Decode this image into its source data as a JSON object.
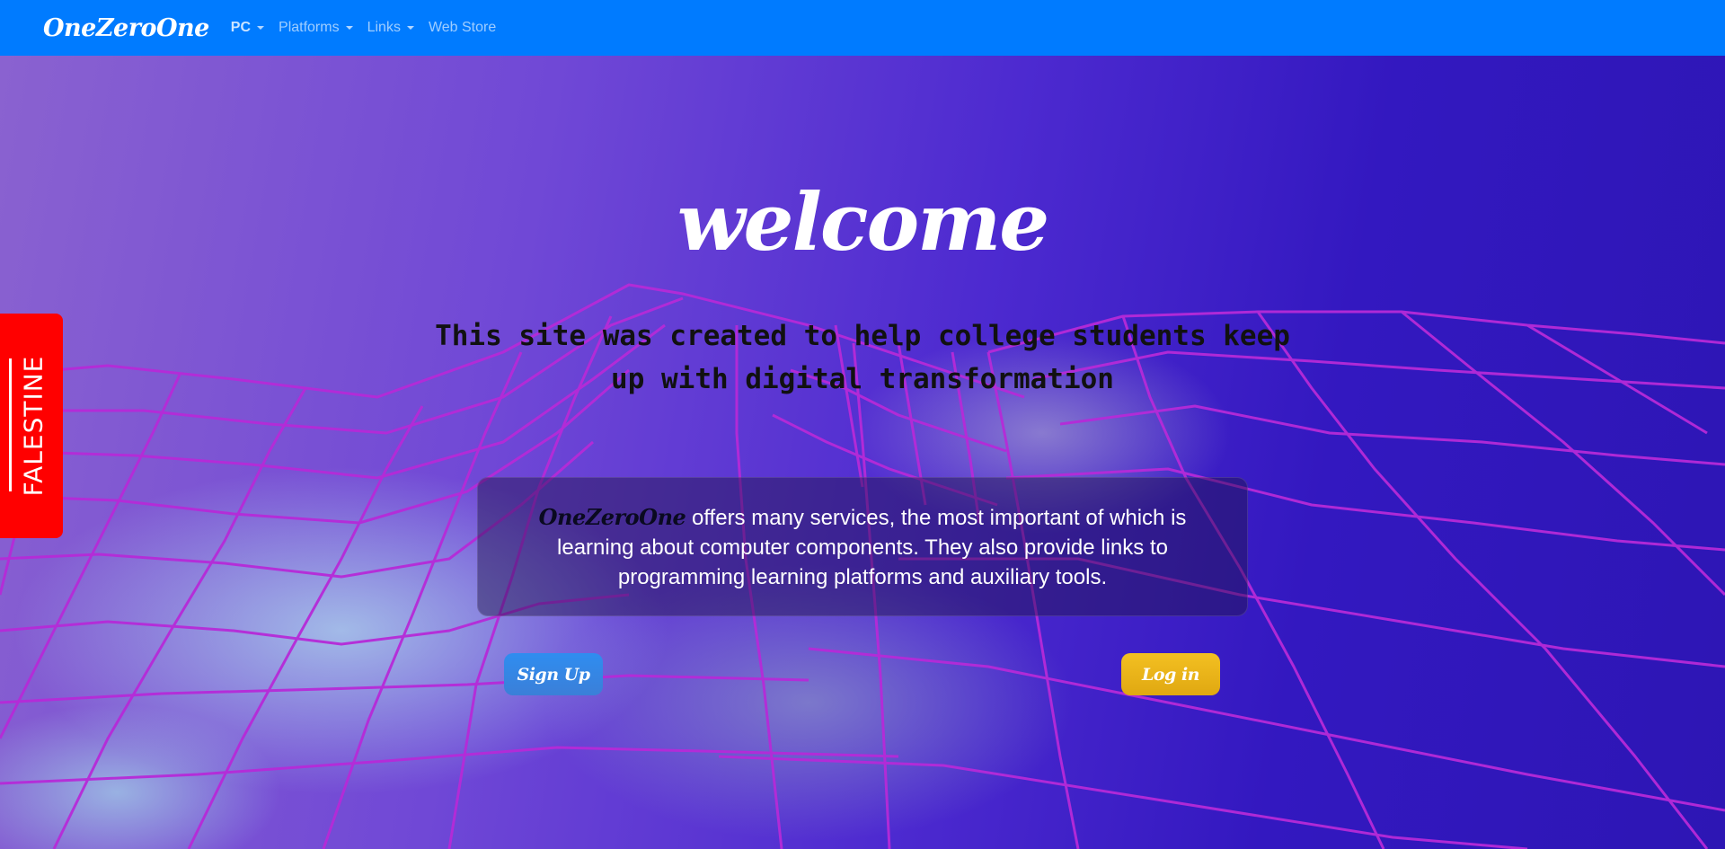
{
  "nav": {
    "brand": "OneZeroOne",
    "items": [
      {
        "label": "PC",
        "dropdown": true
      },
      {
        "label": "Platforms",
        "dropdown": true
      },
      {
        "label": "Links",
        "dropdown": true
      },
      {
        "label": "Web Store",
        "dropdown": false
      }
    ]
  },
  "side_tab": {
    "label": "FALESTINE",
    "color": "#ff0000"
  },
  "hero": {
    "title": "welcome",
    "subtitle": "This site was created to help college students keep up with digital transformation",
    "info_brand": "OneZeroOne",
    "info_text": " offers many services, the most important of which is learning about computer components. They also provide links to programming learning platforms and auxiliary tools."
  },
  "buttons": {
    "signup_label": "Sign Up",
    "login_label": "Log in"
  },
  "colors": {
    "navbar": "#007bff",
    "signup": "#2f8df0",
    "login": "#f3c022",
    "mesh": "#b62ad8"
  }
}
